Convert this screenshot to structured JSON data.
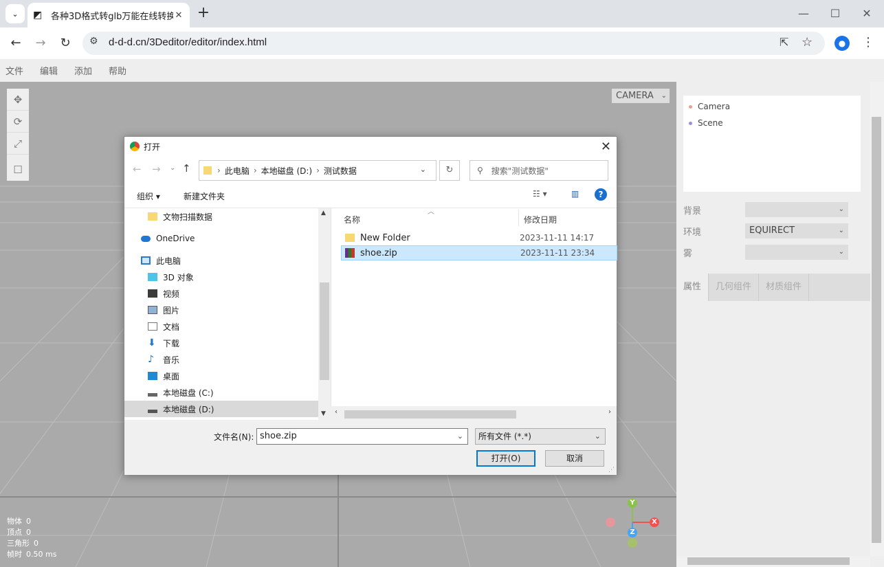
{
  "browser": {
    "tab_title": "各种3D格式转glb万能在线转换",
    "url": "d-d-d.cn/3Deditor/editor/index.html"
  },
  "menu": [
    "文件",
    "编辑",
    "添加",
    "帮助"
  ],
  "viewport": {
    "camera_select": "CAMERA",
    "stats": [
      {
        "label": "物体",
        "value": "0"
      },
      {
        "label": "顶点",
        "value": "0"
      },
      {
        "label": "三角形",
        "value": "0"
      },
      {
        "label": "帧时",
        "value": "0.50 ms"
      }
    ],
    "axes": {
      "y": "Y",
      "x": "X",
      "z": "Z"
    }
  },
  "sidebar": {
    "outliner": [
      {
        "name": "Camera",
        "color": "#e8a090"
      },
      {
        "name": "Scene",
        "color": "#9a8fd8"
      }
    ],
    "scene_props": [
      {
        "label": "背景",
        "value": ""
      },
      {
        "label": "环境",
        "value": "EQUIRECT"
      },
      {
        "label": "雾",
        "value": ""
      }
    ],
    "tabs": [
      "属性",
      "几何组件",
      "材质组件"
    ]
  },
  "dialog": {
    "title": "打开",
    "path": [
      "此电脑",
      "本地磁盘 (D:)",
      "测试数据"
    ],
    "search_placeholder": "搜索\"测试数据\"",
    "organize": "组织 ▾",
    "new_folder": "新建文件夹",
    "nav_items": [
      {
        "label": "文物扫描数据",
        "icon": "folder-icon",
        "indent": 1
      },
      {
        "label": "OneDrive",
        "icon": "cloud-icon",
        "indent": 0
      },
      {
        "label": "此电脑",
        "icon": "computer-icon",
        "indent": 0
      },
      {
        "label": "3D 对象",
        "icon": "cube-icon",
        "indent": 1
      },
      {
        "label": "视频",
        "icon": "video-icon",
        "indent": 1
      },
      {
        "label": "图片",
        "icon": "picture-icon",
        "indent": 1
      },
      {
        "label": "文档",
        "icon": "document-icon",
        "indent": 1
      },
      {
        "label": "下载",
        "icon": "download-icon",
        "indent": 1
      },
      {
        "label": "音乐",
        "icon": "music-icon",
        "indent": 1
      },
      {
        "label": "桌面",
        "icon": "desktop-icon",
        "indent": 1
      },
      {
        "label": "本地磁盘 (C:)",
        "icon": "drive-icon",
        "indent": 1
      },
      {
        "label": "本地磁盘 (D:)",
        "icon": "drive-icon",
        "indent": 1
      }
    ],
    "columns": {
      "name": "名称",
      "date": "修改日期"
    },
    "files": [
      {
        "name": "New Folder",
        "date": "2023-11-11 14:17",
        "icon": "folder-icon",
        "selected": false
      },
      {
        "name": "shoe.zip",
        "date": "2023-11-11 23:34",
        "icon": "zip-icon",
        "selected": true
      }
    ],
    "filename_label": "文件名(N):",
    "filename_value": "shoe.zip",
    "filetype": "所有文件 (*.*)",
    "open_button": "打开(O)",
    "cancel_button": "取消"
  }
}
